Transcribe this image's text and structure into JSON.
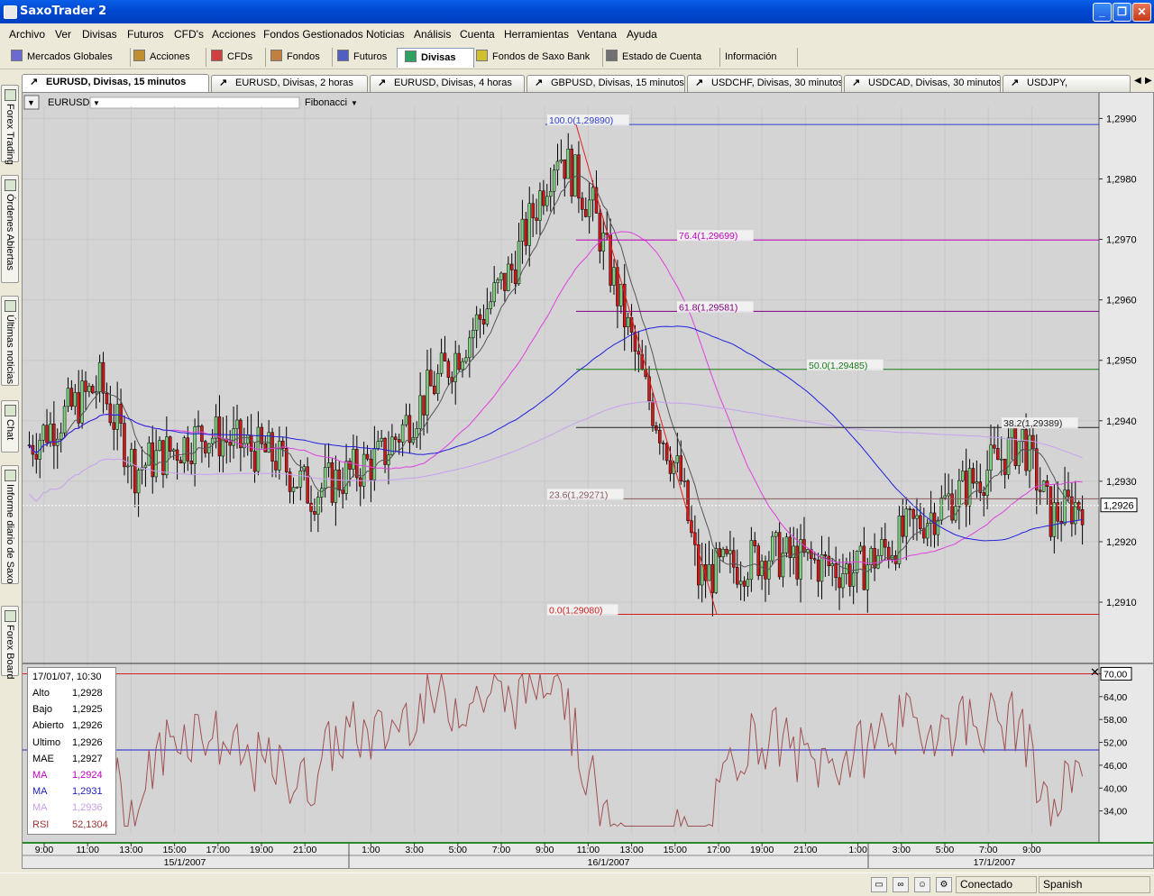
{
  "window": {
    "title": "SaxoTrader 2"
  },
  "menu": [
    "Archivo",
    "Ver",
    "Divisas",
    "Futuros",
    "CFD's",
    "Acciones",
    "Fondos Gestionados",
    "Noticias",
    "Análisis",
    "Cuenta",
    "Herramientas",
    "Ventana",
    "Ayuda"
  ],
  "nav_tabs": [
    {
      "label": "Mercados Globales",
      "icon": "globe-icon"
    },
    {
      "label": "Acciones",
      "icon": "stock-icon"
    },
    {
      "label": "CFDs",
      "icon": "cfd-icon"
    },
    {
      "label": "Fondos",
      "icon": "fund-icon"
    },
    {
      "label": "Futuros",
      "icon": "futures-icon"
    },
    {
      "label": "Divisas",
      "icon": "fx-icon",
      "selected": true
    },
    {
      "label": "Fondos de Saxo Bank",
      "icon": "saxo-fund-icon"
    },
    {
      "label": "Estado de Cuenta",
      "icon": "account-icon"
    },
    {
      "label": "Información",
      "icon": ""
    }
  ],
  "chart_tabs": [
    {
      "label": "EURUSD, Divisas, 15 minutos",
      "selected": true
    },
    {
      "label": "EURUSD, Divisas, 2 horas"
    },
    {
      "label": "EURUSD, Divisas, 4 horas"
    },
    {
      "label": "GBPUSD, Divisas, 15 minutos"
    },
    {
      "label": "USDCHF, Divisas, 30 minutos"
    },
    {
      "label": "USDCAD, Divisas, 30 minutos"
    },
    {
      "label": "USDJPY,"
    }
  ],
  "sidebar": [
    "Forex Trading",
    "Órdenes Abiertas",
    "Últimas noticias",
    "Chat",
    "Informe diario de Saxo",
    "Forex Board"
  ],
  "chart_toolbar": {
    "instrument": "EURUSD",
    "tool": "Fibonacci"
  },
  "chart_data": {
    "type": "candlestick",
    "instrument": "EURUSD",
    "price_ticks": [
      "1,2990",
      "1,2980",
      "1,2970",
      "1,2960",
      "1,2950",
      "1,2940",
      "1,2930",
      "1,2920",
      "1,2910"
    ],
    "price_tick_values": [
      1.299,
      1.298,
      1.297,
      1.296,
      1.295,
      1.294,
      1.293,
      1.292,
      1.291
    ],
    "ylim": [
      1.2903,
      1.2992
    ],
    "current_price": "1,2926",
    "fibonacci": [
      {
        "label": "100.0(1,29890)",
        "value": 1.2989,
        "color": "#3040d0"
      },
      {
        "label": "76.4(1,29699)",
        "value": 1.29699,
        "color": "#c000c0"
      },
      {
        "label": "61.8(1,29581)",
        "value": 1.29581,
        "color": "#800080"
      },
      {
        "label": "50.0(1,29485)",
        "value": 1.29485,
        "color": "#1a7a1a"
      },
      {
        "label": "38.2(1,29389)",
        "value": 1.29389,
        "color": "#202020"
      },
      {
        "label": "23.6(1,29271)",
        "value": 1.29271,
        "color": "#8a5a5a"
      },
      {
        "label": "0.0(1,29080)",
        "value": 1.2908,
        "color": "#d02020"
      }
    ],
    "time_ticks": [
      "9:00",
      "11:00",
      "13:00",
      "15:00",
      "17:00",
      "19:00",
      "21:00",
      "1:00",
      "3:00",
      "5:00",
      "7:00",
      "9:00",
      "11:00",
      "13:00",
      "15:00",
      "17:00",
      "19:00",
      "21:00",
      "1:00",
      "3:00",
      "5:00",
      "7:00",
      "9:00"
    ],
    "date_labels": [
      "15/1/2007",
      "16/1/2007",
      "17/1/2007"
    ],
    "rsi": {
      "ticks": [
        "70,00",
        "64,00",
        "58,00",
        "52,00",
        "46,00",
        "40,00",
        "34,00"
      ],
      "tick_values": [
        70,
        64,
        58,
        52,
        46,
        40,
        34
      ],
      "level_high": "70,00",
      "level_mid": "50,00",
      "ylim": [
        28,
        72
      ]
    }
  },
  "info_box": {
    "datetime": "17/01/07, 10:30",
    "rows": [
      {
        "label": "Alto",
        "value": "1,2928",
        "color": "#000000"
      },
      {
        "label": "Bajo",
        "value": "1,2925",
        "color": "#000000"
      },
      {
        "label": "Abierto",
        "value": "1,2926",
        "color": "#000000"
      },
      {
        "label": "Ultimo",
        "value": "1,2926",
        "color": "#000000"
      },
      {
        "label": "MAE",
        "value": "1,2927",
        "color": "#000000"
      },
      {
        "label": "MA",
        "value": "1,2924",
        "color": "#c000c0"
      },
      {
        "label": "MA",
        "value": "1,2931",
        "color": "#2020c0"
      },
      {
        "label": "MA",
        "value": "1,2936",
        "color": "#c8a0e8"
      },
      {
        "label": "RSI",
        "value": "52,1304",
        "color": "#a03030"
      }
    ]
  },
  "status": {
    "connection": "Conectado",
    "language": "Spanish"
  }
}
